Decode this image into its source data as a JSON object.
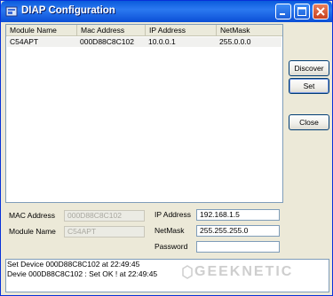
{
  "window": {
    "title": "DIAP Configuration"
  },
  "devices_table": {
    "columns": [
      "Module Name",
      "Mac Address",
      "IP Address",
      "NetMask"
    ],
    "rows": [
      [
        "C54APT",
        "000D88C8C102",
        "10.0.0.1",
        "255.0.0.0"
      ]
    ]
  },
  "buttons": {
    "discover": "Discover",
    "set": "Set",
    "close": "Close"
  },
  "form": {
    "mac_label": "MAC Address",
    "mac_value": "000D88C8C102",
    "module_label": "Module Name",
    "module_value": "C54APT",
    "ip_label": "IP Address",
    "ip_value": "192.168.1.5",
    "netmask_label": "NetMask",
    "netmask_value": "255.255.255.0",
    "password_label": "Password",
    "password_value": ""
  },
  "log": {
    "lines": [
      "Set Device 000D88C8C102 at 22:49:45",
      "Devie 000D88C8C102 : Set OK ! at 22:49:45"
    ]
  },
  "watermark": {
    "text": "GEEKNETIC"
  }
}
